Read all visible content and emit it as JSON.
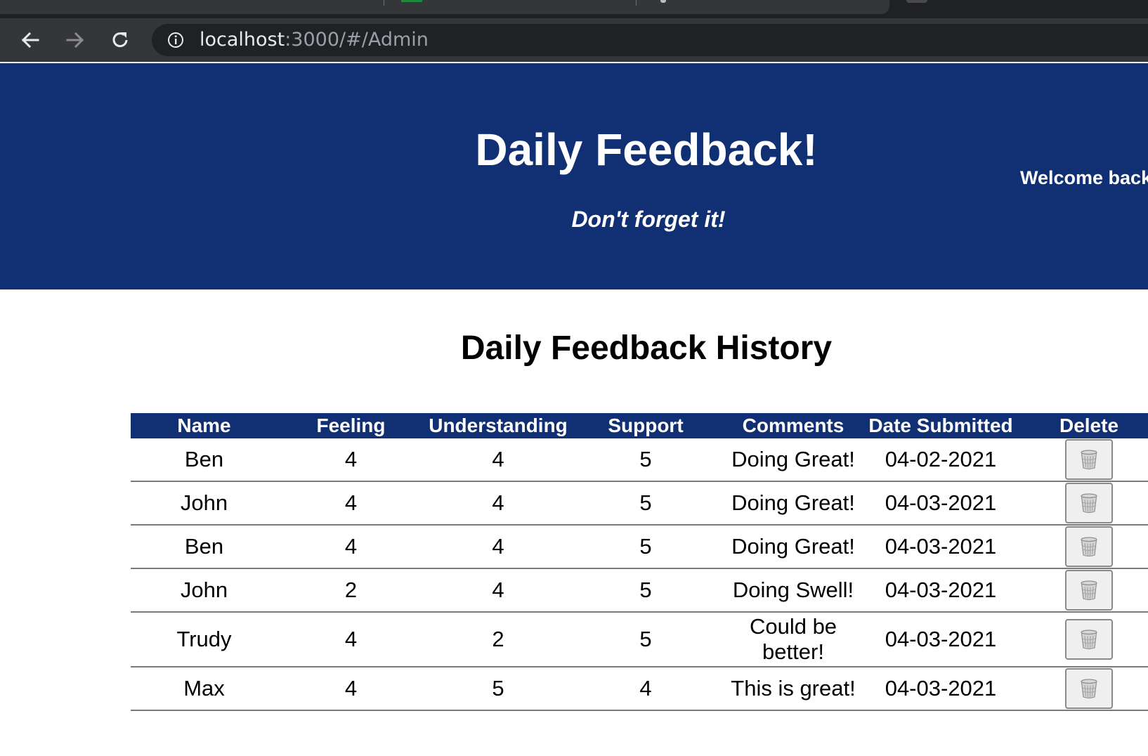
{
  "browser": {
    "url_host": "localhost",
    "url_path": ":3000/#/Admin"
  },
  "header": {
    "title": "Daily Feedback!",
    "tagline": "Don't forget it!",
    "welcome": "Welcome back"
  },
  "history": {
    "title": "Daily Feedback History",
    "columns": [
      "Name",
      "Feeling",
      "Understanding",
      "Support",
      "Comments",
      "Date Submitted",
      "Delete"
    ],
    "rows": [
      {
        "name": "Ben",
        "feeling": "4",
        "understanding": "4",
        "support": "5",
        "comments": "Doing Great!",
        "date": "04-02-2021"
      },
      {
        "name": "John",
        "feeling": "4",
        "understanding": "4",
        "support": "5",
        "comments": "Doing Great!",
        "date": "04-03-2021"
      },
      {
        "name": "Ben",
        "feeling": "4",
        "understanding": "4",
        "support": "5",
        "comments": "Doing Great!",
        "date": "04-03-2021"
      },
      {
        "name": "John",
        "feeling": "2",
        "understanding": "4",
        "support": "5",
        "comments": "Doing Swell!",
        "date": "04-03-2021"
      },
      {
        "name": "Trudy",
        "feeling": "4",
        "understanding": "2",
        "support": "5",
        "comments": "Could be better!",
        "date": "04-03-2021"
      },
      {
        "name": "Max",
        "feeling": "4",
        "understanding": "5",
        "support": "4",
        "comments": "This is great!",
        "date": "04-03-2021"
      }
    ],
    "delete_icon": "trash-icon"
  },
  "colors": {
    "header_bg": "#103073",
    "chrome_bg": "#35363a"
  }
}
